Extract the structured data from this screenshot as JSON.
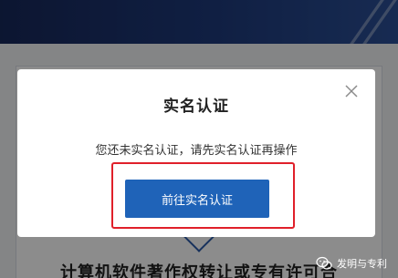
{
  "background_page": {
    "section_heading": "计算机软件著作权转让或专有许可合"
  },
  "modal": {
    "title": "实名认证",
    "message": "您还未实名认证，请先实名认证再操作",
    "primary_button_label": "前往实名认证",
    "close_icon": "close-icon"
  },
  "watermark": {
    "text": "发明与专利",
    "icon": "wechat-icon"
  },
  "colors": {
    "primary": "#1f63b8",
    "highlight_border": "#e0202a",
    "header_dark": "#17285a",
    "overlay": "rgba(0,0,0,0.45)"
  }
}
